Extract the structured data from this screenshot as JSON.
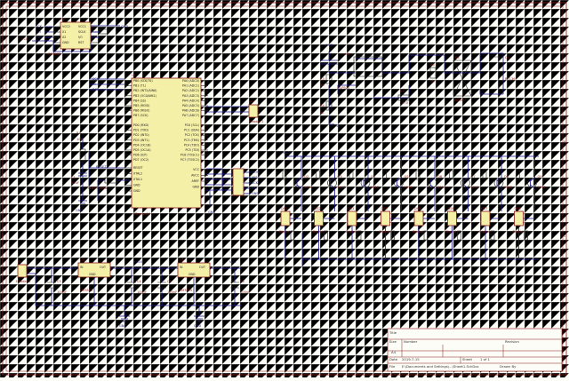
{
  "frame": {
    "border_color": "#8a1a1a",
    "wire_color": "#1a1a8c",
    "part_fill": "#f5f0a8",
    "col_marks": [
      "1",
      "2",
      "3",
      "4"
    ],
    "row_marks": [
      "A",
      "B",
      "C",
      "D"
    ]
  },
  "rtc": {
    "designator": "U2",
    "part": "DS1302",
    "pins_left": [
      "VCC2",
      "X1",
      "X2",
      "GND"
    ],
    "pins_right": [
      "VCC1",
      "SCLK",
      "I/O",
      "RST"
    ],
    "nets": [
      "SCK",
      "IO",
      "RST",
      "VCC",
      "GND"
    ]
  },
  "mcu": {
    "designator": "U1",
    "part": "ATmega16",
    "pins_left": [
      "PB0 (XCK/T0)",
      "PB1 (T1)",
      "PB2 (INT2/AIN0)",
      "PB3 (OC0/AIN1)",
      "PB4 (SS)",
      "PB5 (MOSI)",
      "PB6 (MISO)",
      "PB7 (SCK)",
      "PD0 (RXD)",
      "PD1 (TXD)",
      "PD2 (INT0)",
      "PD3 (INT1)",
      "PD4 (OC1B)",
      "PD5 (OC1A)",
      "PD6 (ICP)",
      "PD7 (OC2)",
      "RESET",
      "XTAL2",
      "XTAL1",
      "GND",
      "GND"
    ],
    "pins_right": [
      "PA0 (ADC0)",
      "PA1 (ADC1)",
      "PA2 (ADC2)",
      "PA3 (ADC3)",
      "PA4 (ADC4)",
      "PA5 (ADC5)",
      "PA6 (ADC6)",
      "PA7 (ADC7)",
      "PC0 (SCL)",
      "PC1 (SDA)",
      "PC2 (TCK)",
      "PC3 (TMS)",
      "PC4 (TDO)",
      "PC5 (TDI)",
      "PC6 (TOSC1)",
      "PC7 (TOSC2)",
      "VCC",
      "AVCC",
      "AREF",
      "GND"
    ],
    "net_reset": "RESET",
    "net_int": "INT0"
  },
  "reset_circuit": {
    "r": "R1",
    "r_val": "10K",
    "c": "C1",
    "c_val": "10uF",
    "xtal": "Y1",
    "xtal_val": "11.0592MHz"
  },
  "header": {
    "designator": "P2",
    "part": "Header 2"
  },
  "isp": {
    "nets": [
      "MOSI",
      "MISO",
      "SCK",
      "RST",
      "GND"
    ]
  },
  "optocoupler": {
    "designator": "U3",
    "part": "TLP521",
    "r1": "R3",
    "r1_val": "1K",
    "r2": "R4",
    "r2_val": "1K",
    "r3": "R5",
    "r3_val": "470",
    "vcc": "VCC"
  },
  "triac": {
    "designator": "Q1",
    "part": "BT136",
    "r": "R6",
    "r_val": "1K",
    "bridge": "D1",
    "bridge_val": "1N4007"
  },
  "display": {
    "net": "VCC",
    "transistor_prefix": "Q",
    "transistor_part": "9012",
    "digit_prefix": "DS",
    "digit_part": "Digital",
    "count": 8
  },
  "power": {
    "input_designator": "P1",
    "input_part": "Header 2",
    "reg1": "U4",
    "reg1_part": "LM7812",
    "reg2": "U5",
    "reg2_part": "LM7805",
    "caps": [
      {
        "ref": "C3",
        "val": "100uF"
      },
      {
        "ref": "C4",
        "val": "100nF"
      },
      {
        "ref": "C5",
        "val": "100nF"
      },
      {
        "ref": "C6",
        "val": "100uF"
      }
    ],
    "labels": [
      "IN",
      "OUT",
      "GND"
    ],
    "rails": [
      "+12V",
      "VCC"
    ]
  },
  "title_block": {
    "title_label": "Title",
    "size_label": "Size",
    "size_val": "A4",
    "number_label": "Number",
    "revision_label": "Revision",
    "date_label": "Date",
    "date_val": "2019-7-15",
    "sheet_label": "Sheet",
    "sheet_val": "1 of 1",
    "file_label": "File",
    "file_val": "E:\\Documents and Settings\\...\\Sheet1.SchDoc",
    "drawn_label": "Drawn By"
  }
}
